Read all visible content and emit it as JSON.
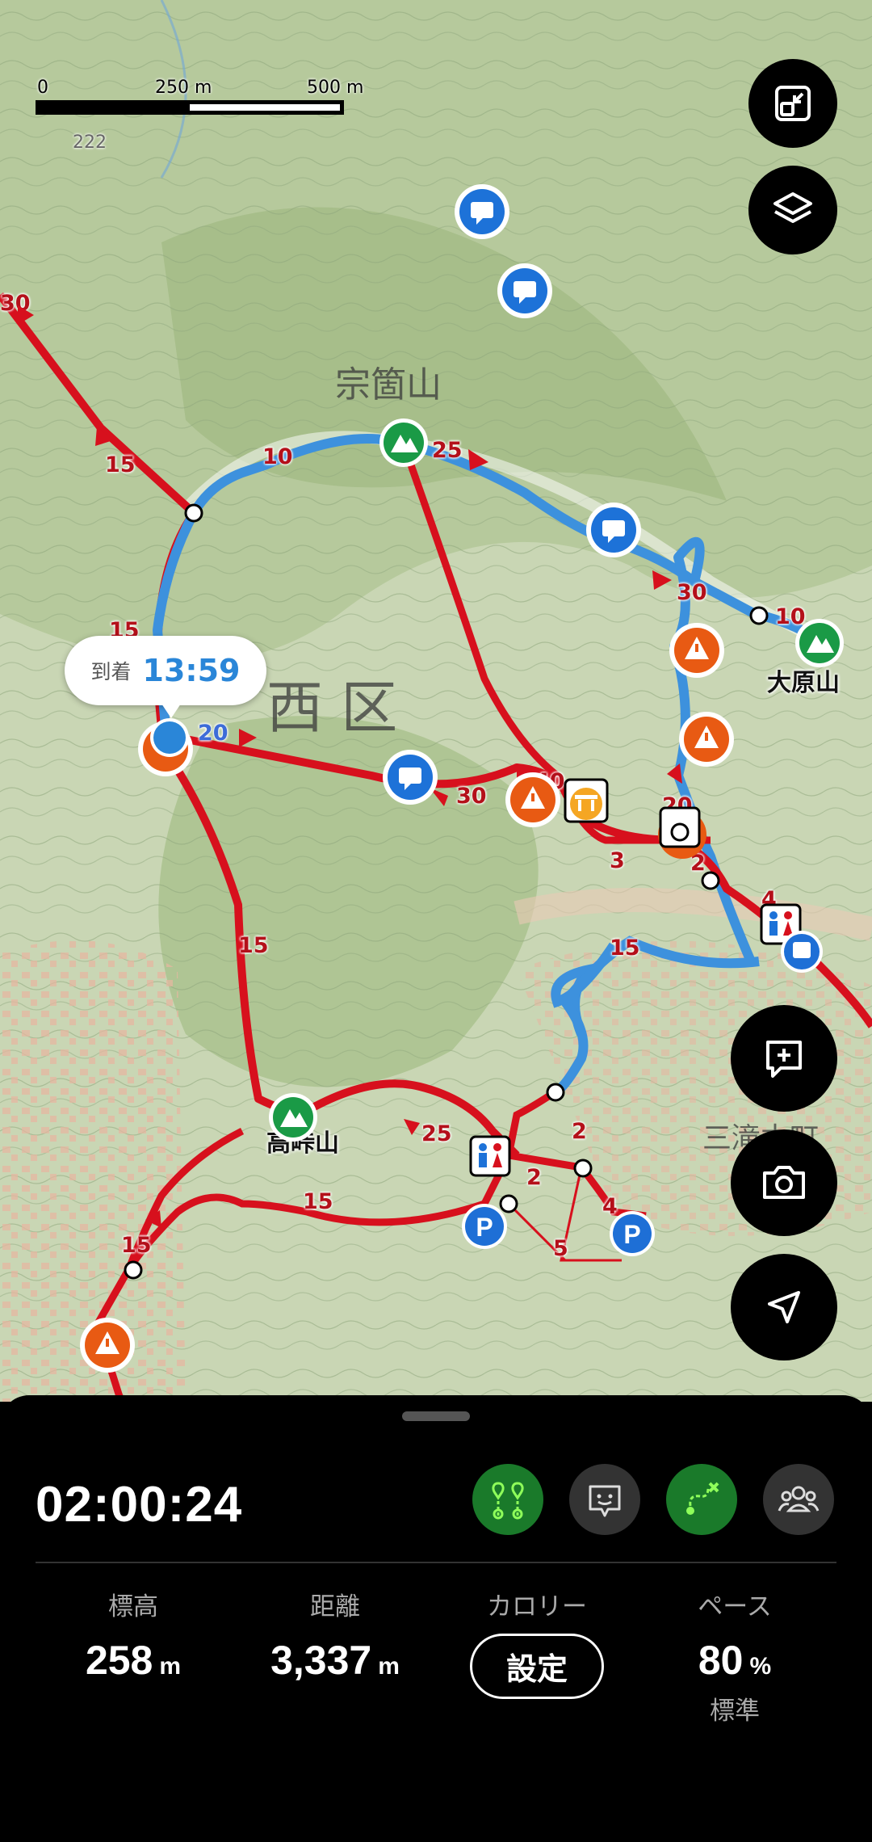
{
  "map": {
    "scale": {
      "zero": "0",
      "mid": "250 m",
      "max": "500 m"
    },
    "contour_label": "222",
    "place_labels": {
      "mountain1": "宗箇山",
      "district": "西 区",
      "mountain2": "大原山",
      "mountain3": "高峠山",
      "town": "三滝本町"
    },
    "segment_numbers": [
      "30",
      "15",
      "10",
      "25",
      "30",
      "10",
      "15",
      "20",
      "40",
      "30",
      "3",
      "2",
      "4",
      "20",
      "15",
      "15",
      "25",
      "2",
      "2",
      "15",
      "15",
      "4",
      "5"
    ],
    "arrival_bubble": {
      "label": "到着",
      "time": "13:59"
    },
    "colors": {
      "route_red": "#d7101d",
      "route_blue": "#3d91dd",
      "warning": "#e85a13",
      "peak": "#1a9a46",
      "memo": "#1d72d8",
      "parking": "#1e6fd6"
    }
  },
  "controls": {
    "icons": [
      "fullscreen-exit-icon",
      "layers-icon",
      "add-memo-icon",
      "camera-icon",
      "navigate-icon"
    ]
  },
  "panel": {
    "timer": "02:00:24",
    "toggles": [
      {
        "name": "markers-toggle",
        "active": true
      },
      {
        "name": "mascot-toggle",
        "active": false
      },
      {
        "name": "route-toggle",
        "active": true
      },
      {
        "name": "group-toggle",
        "active": false
      }
    ],
    "stats": {
      "altitude": {
        "label": "標高",
        "value": "258",
        "unit": "m"
      },
      "distance": {
        "label": "距離",
        "value": "3,337",
        "unit": "m"
      },
      "calorie": {
        "label": "カロリー",
        "button": "設定"
      },
      "pace": {
        "label": "ペース",
        "value": "80",
        "unit": "%",
        "sub": "標準"
      }
    }
  }
}
